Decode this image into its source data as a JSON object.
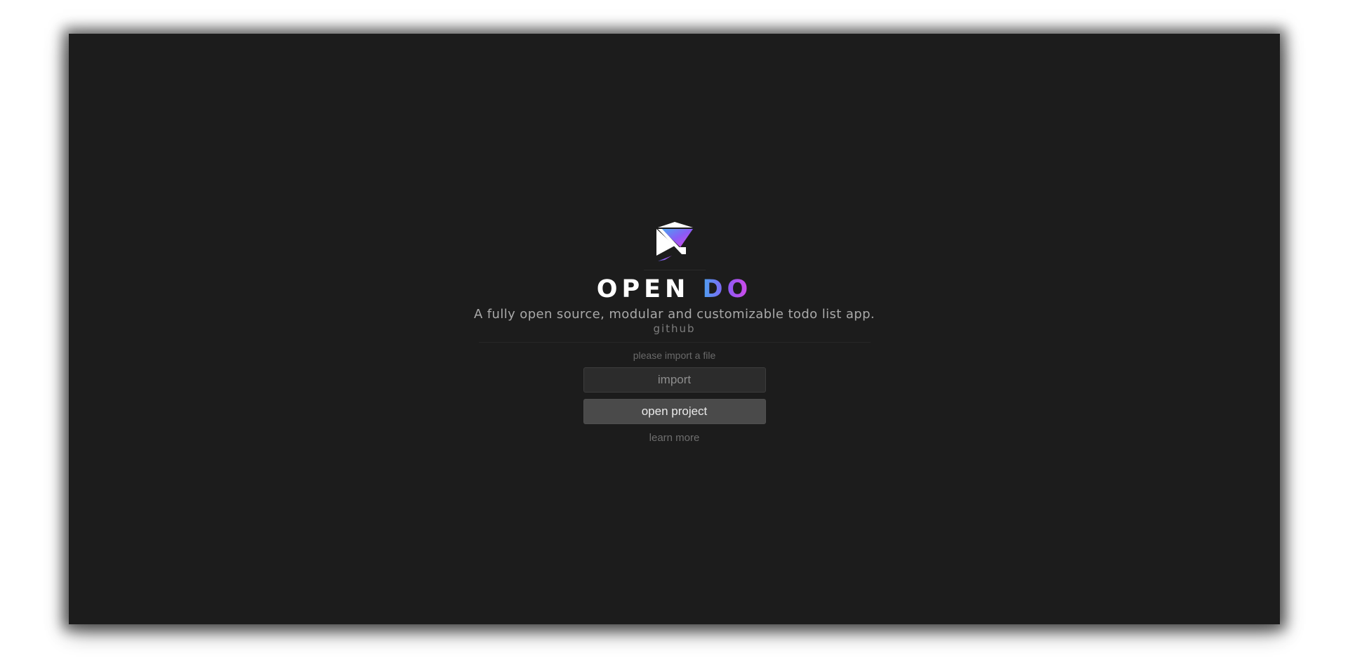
{
  "app": {
    "title_main": "OPEN ",
    "title_accent": "DO",
    "tagline": "A fully open source, modular and customizable todo list app.",
    "github_link": "github",
    "logo_icon": "open-do-logo-icon"
  },
  "start": {
    "hint": "please import a file",
    "import_label": "import",
    "open_project_label": "open project",
    "learn_more": "learn more"
  },
  "colors": {
    "background": "#1c1c1c",
    "accent_start": "#4aa3f0",
    "accent_mid": "#8a5cf6",
    "accent_end": "#e046e6"
  }
}
